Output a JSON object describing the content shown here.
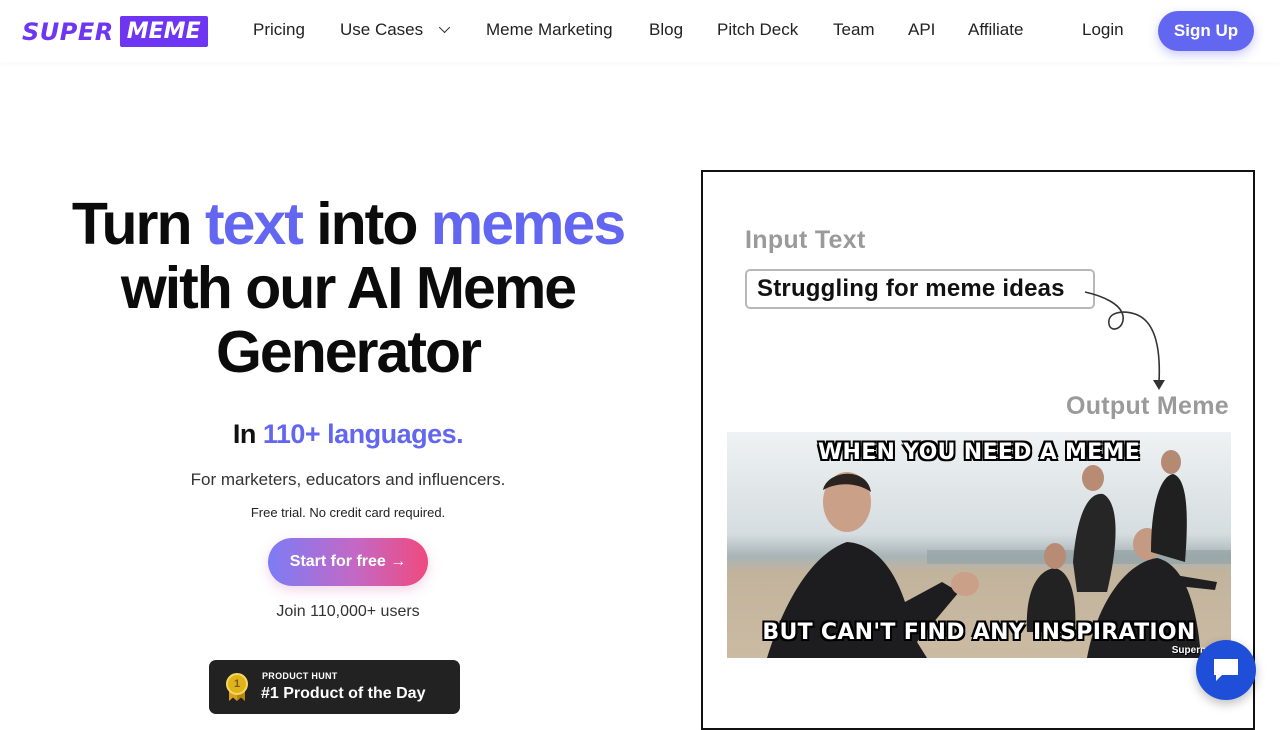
{
  "brand": {
    "logo_part1": "SUPER",
    "logo_part2": "MEME",
    "accent_color": "#6366f1",
    "logo_color": "#6e35f2"
  },
  "nav": {
    "items": [
      "Pricing",
      "Use Cases",
      "Meme Marketing",
      "Blog",
      "Pitch Deck",
      "Team",
      "API",
      "Affiliate"
    ],
    "login": "Login",
    "signup": "Sign Up"
  },
  "hero": {
    "title_1": "Turn ",
    "title_2": "text",
    "title_3": " into ",
    "title_4": "memes",
    "title_5": "with our AI Meme Generator",
    "lang_prefix": "In ",
    "lang_accent": "110+ languages.",
    "subtitle": "For marketers, educators and influencers.",
    "trial": "Free trial. No credit card required.",
    "cta": "Start for free →",
    "join": "Join 110,000+ users"
  },
  "badge": {
    "medal": "1",
    "small": "PRODUCT HUNT",
    "big": "#1 Product of the Day"
  },
  "demo": {
    "input_label": "Input Text",
    "input_value": "Struggling for meme ideas",
    "output_label": "Output Meme",
    "meme_top": "WHEN YOU NEED A MEME",
    "meme_bottom": "BUT CAN'T FIND ANY INSPIRATION",
    "watermark": "Supermeme"
  },
  "icons": {
    "chat": "chat-bubble-icon",
    "dropdown": "chevron-down-icon",
    "medal": "medal-icon",
    "arrow": "curved-arrow-icon"
  }
}
